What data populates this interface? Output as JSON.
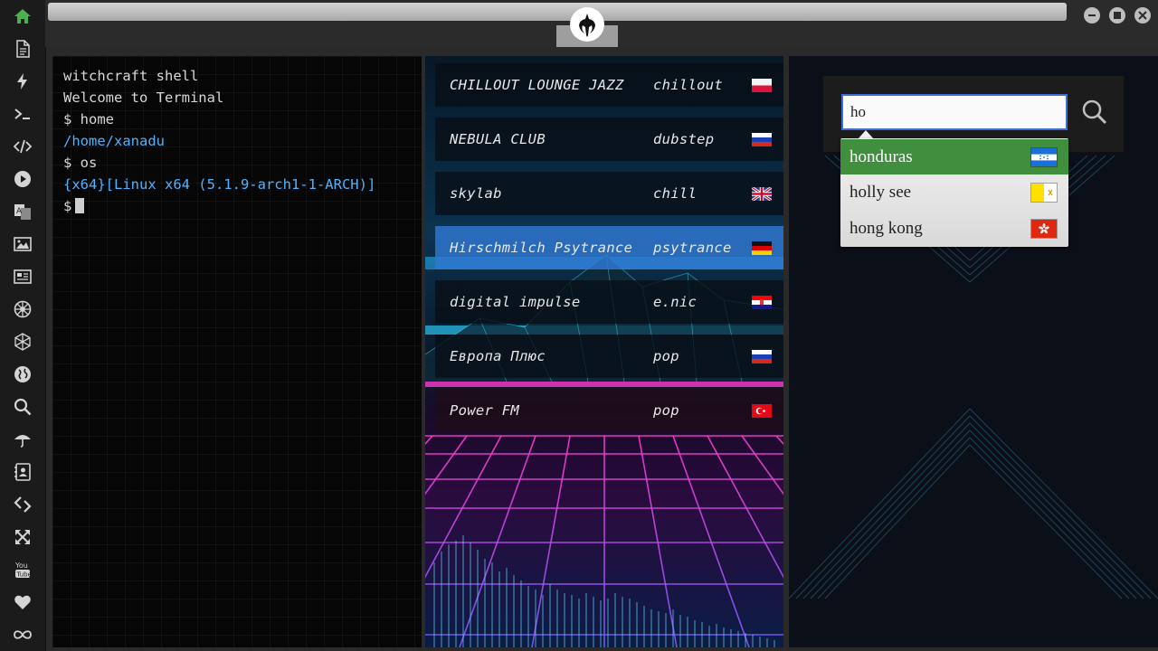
{
  "sidebar": {
    "items": [
      {
        "name": "home",
        "icon": "home-icon",
        "active": true
      },
      {
        "name": "file",
        "icon": "document-icon"
      },
      {
        "name": "power",
        "icon": "lightning-icon"
      },
      {
        "name": "terminal",
        "icon": "terminal-icon"
      },
      {
        "name": "code",
        "icon": "code-icon"
      },
      {
        "name": "media",
        "icon": "play-icon"
      },
      {
        "name": "translate",
        "icon": "translate-icon"
      },
      {
        "name": "images",
        "icon": "image-icon"
      },
      {
        "name": "news",
        "icon": "newspaper-icon"
      },
      {
        "name": "empire",
        "icon": "empire-icon"
      },
      {
        "name": "cube",
        "icon": "hexagon-icon"
      },
      {
        "name": "world",
        "icon": "globe-icon"
      },
      {
        "name": "search",
        "icon": "search-icon"
      },
      {
        "name": "umbrella",
        "icon": "umbrella-icon"
      },
      {
        "name": "contacts",
        "icon": "address-book-icon"
      },
      {
        "name": "network",
        "icon": "diamond-link-icon"
      },
      {
        "name": "fullscreen",
        "icon": "expand-icon"
      },
      {
        "name": "youtube",
        "icon": "youtube-icon"
      },
      {
        "name": "favorites",
        "icon": "heart-icon"
      },
      {
        "name": "infinity",
        "icon": "infinity-icon"
      }
    ]
  },
  "window": {
    "logo_icon": "rebel-alliance-icon",
    "controls": [
      "minimize-icon",
      "maximize-icon",
      "close-icon"
    ]
  },
  "terminal": {
    "lines": [
      {
        "text": "witchcraft shell",
        "color": "white"
      },
      {
        "text": "Welcome to Terminal",
        "color": "white"
      },
      {
        "text": "$ home",
        "color": "white"
      },
      {
        "text": "/home/xanadu",
        "color": "blue"
      },
      {
        "text": "$ os",
        "color": "white"
      },
      {
        "text": "{x64}[Linux x64 (5.1.9-arch1-1-ARCH)]",
        "color": "blue"
      }
    ],
    "prompt": "$"
  },
  "radio": {
    "stations": [
      {
        "name": "CHILLOUT LOUNGE JAZZ",
        "genre": "chillout",
        "flag": "poland"
      },
      {
        "name": "NEBULA CLUB",
        "genre": "dubstep",
        "flag": "russia"
      },
      {
        "name": "skylab",
        "genre": "chill",
        "flag": "uk"
      },
      {
        "name": "Hirschmilch Psytrance",
        "genre": "psytrance",
        "flag": "germany",
        "active": true
      },
      {
        "name": "digital impulse",
        "genre": "e.nic",
        "flag": "croatia"
      },
      {
        "name": "Европа Плюс",
        "genre": "pop",
        "flag": "russia"
      },
      {
        "name": "Power FM",
        "genre": "pop",
        "flag": "turkey"
      }
    ]
  },
  "search": {
    "value": "ho",
    "icon": "search-icon",
    "suggestions": [
      {
        "label": "honduras",
        "flag": "honduras",
        "selected": true
      },
      {
        "label": "holly see",
        "flag": "vatican"
      },
      {
        "label": "hong kong",
        "flag": "hong-kong"
      }
    ]
  },
  "colors": {
    "accent_green": "#3f8f3f",
    "terminal_blue": "#4fb3ff",
    "input_border": "#3d6fd6"
  }
}
